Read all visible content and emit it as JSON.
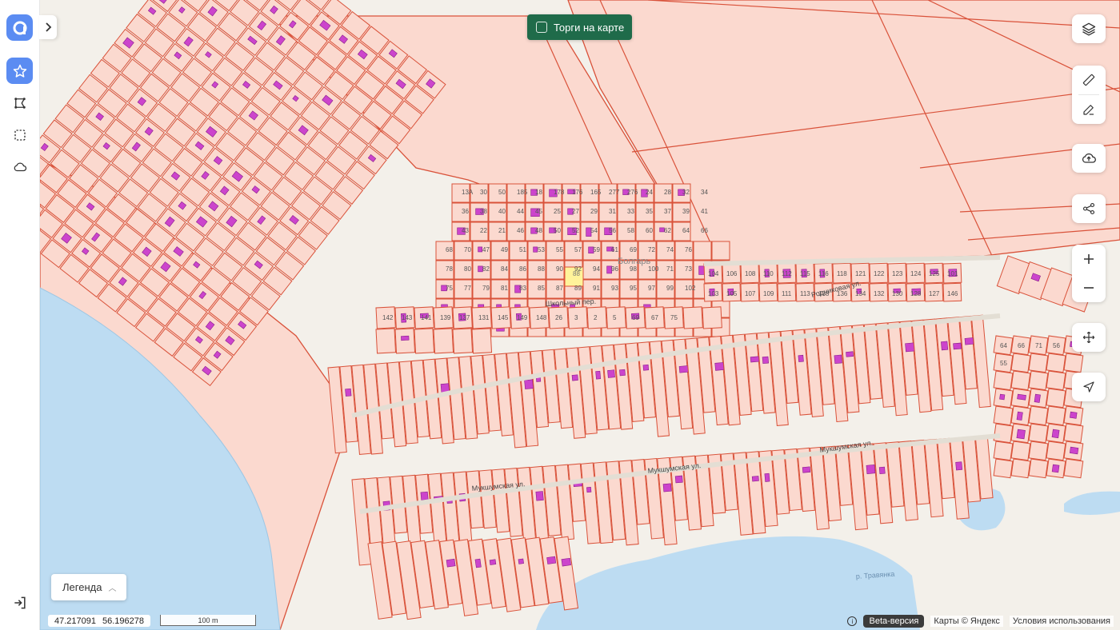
{
  "sidebar": {
    "logo_icon": "app-logo-icon",
    "items": [
      {
        "name": "favorites",
        "icon": "star-icon",
        "active": true
      },
      {
        "name": "routes",
        "icon": "route-icon",
        "active": false
      },
      {
        "name": "select-area",
        "icon": "dashed-square-icon",
        "active": false
      },
      {
        "name": "weather",
        "icon": "cloud-icon",
        "active": false
      }
    ],
    "exit_icon": "logout-icon"
  },
  "top": {
    "auction_label": "Торги на карте",
    "auction_checked": false
  },
  "controls": [
    {
      "group": "layers",
      "icons": [
        "layers-icon"
      ]
    },
    {
      "group": "tools",
      "icons": [
        "ruler-icon",
        "edit-icon"
      ]
    },
    {
      "group": "upload",
      "icons": [
        "cloud-upload-icon"
      ]
    },
    {
      "group": "share",
      "icons": [
        "share-icon"
      ]
    },
    {
      "group": "zoom",
      "icons": [
        "plus-icon",
        "minus-icon"
      ]
    },
    {
      "group": "move",
      "icons": [
        "move-icon"
      ]
    },
    {
      "group": "locate",
      "icons": [
        "navigation-icon"
      ]
    }
  ],
  "legend": {
    "label": "Легенда"
  },
  "footer": {
    "lon": "47.217091",
    "lat": "56.196278",
    "scale_label": "100 m",
    "beta_label": "Beta-версия",
    "maps_label": "Карты © Яндекс",
    "terms_label": "Условия использования"
  },
  "map": {
    "streets": [
      "Родниковая ул.",
      "Мукшумская ул.",
      "Мукшумская ул.",
      "Мукшумская ул.",
      "Школьный пер.",
      "Болгарь",
      "р. Травянка"
    ],
    "parcel_numbers": [
      "13А",
      "30",
      "50",
      "185",
      "18",
      "178",
      "176",
      "165",
      "277",
      "276",
      "24",
      "28",
      "32",
      "34",
      "36",
      "38",
      "40",
      "44",
      "45",
      "25",
      "27",
      "29",
      "31",
      "33",
      "35",
      "37",
      "39",
      "41",
      "43",
      "22",
      "21",
      "46",
      "48",
      "50",
      "52",
      "54",
      "56",
      "58",
      "60",
      "62",
      "64",
      "66",
      "68",
      "70",
      "47",
      "49",
      "51",
      "53",
      "55",
      "57",
      "59",
      "61",
      "69",
      "72",
      "74",
      "76",
      "78",
      "80",
      "82",
      "84",
      "86",
      "88",
      "90",
      "92",
      "94",
      "96",
      "98",
      "100",
      "71",
      "73",
      "75",
      "77",
      "79",
      "81",
      "83",
      "85",
      "87",
      "89",
      "91",
      "93",
      "95",
      "97",
      "99",
      "102",
      "104",
      "106",
      "108",
      "110",
      "112",
      "115",
      "116",
      "118",
      "121",
      "122",
      "123",
      "124",
      "125",
      "101",
      "103",
      "105",
      "107",
      "109",
      "111",
      "113",
      "138",
      "136",
      "134",
      "132",
      "130",
      "128",
      "127",
      "146",
      "142",
      "143",
      "141",
      "139",
      "137",
      "131",
      "145",
      "149",
      "148",
      "26",
      "3",
      "2",
      "5",
      "69",
      "67",
      "75",
      "64",
      "66",
      "71",
      "56",
      "55"
    ],
    "highlighted_parcel": "88",
    "colors": {
      "water": "#bddcf2",
      "parcel_fill": "#fbd9cf",
      "parcel_stroke": "#d9523a",
      "building": "#cc44cc",
      "land": "#f3f0ea",
      "highlight": "#fff39a"
    }
  }
}
